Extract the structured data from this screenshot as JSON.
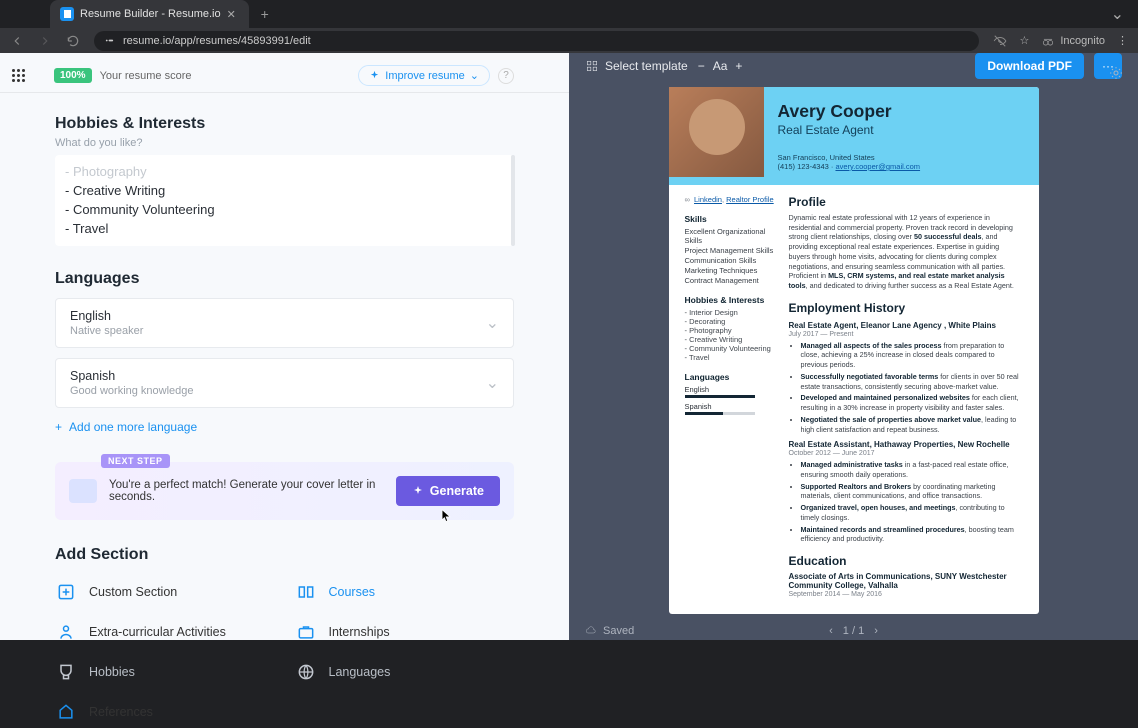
{
  "browser": {
    "tab_title": "Resume Builder - Resume.io",
    "url": "resume.io/app/resumes/45893991/edit",
    "incognito": "Incognito"
  },
  "topbar": {
    "score": "100%",
    "score_label": "Your resume score",
    "improve": "Improve resume"
  },
  "hobbies": {
    "title": "Hobbies & Interests",
    "hint": "What do you like?",
    "items": [
      "- Photography",
      "- Creative Writing",
      "- Community Volunteering",
      "- Travel"
    ]
  },
  "languages": {
    "title": "Languages",
    "items": [
      {
        "name": "English",
        "level": "Native speaker"
      },
      {
        "name": "Spanish",
        "level": "Good working knowledge"
      }
    ],
    "add": "Add one more language"
  },
  "nextstep": {
    "tag": "NEXT STEP",
    "text": "You're a perfect match! Generate your cover letter in seconds.",
    "button": "Generate"
  },
  "addsection": {
    "title": "Add Section",
    "items": {
      "custom": "Custom Section",
      "courses": "Courses",
      "extra": "Extra-curricular Activities",
      "intern": "Internships",
      "hobbies": "Hobbies",
      "languages": "Languages",
      "refs": "References"
    }
  },
  "previewbar": {
    "select_template": "Select template",
    "download": "Download PDF",
    "aa": "Aa"
  },
  "resume": {
    "name": "Avery Cooper",
    "role": "Real Estate Agent",
    "location": "San Francisco, United States",
    "phone": "(415) 123-4343",
    "email": "avery.cooper@gmail.com",
    "links_label": "Linkedin",
    "links_label2": "Realtor Profile",
    "skills_h": "Skills",
    "skills": [
      "Excellent Organizational Skills",
      "Project Management Skills",
      "Communication Skills",
      "Marketing Techniques",
      "Contract Management"
    ],
    "hobbies_h": "Hobbies & Interests",
    "hobbies": [
      "- Interior Design",
      "- Decorating",
      "- Photography",
      "- Creative Writing",
      "- Community Volunteering",
      "- Travel"
    ],
    "langs_h": "Languages",
    "profile_h": "Profile",
    "profile_body_pre": "Dynamic real estate professional with 12 years of experience in residential and commercial property. Proven track record in developing strong client relationships, closing over ",
    "profile_b1": "50 successful deals",
    "profile_mid": ", and providing exceptional real estate experiences. Expertise in guiding buyers through home visits, advocating for clients during complex negotiations, and ensuring seamless communication with all parties. Proficient in ",
    "profile_b2": "MLS, CRM systems, and real estate market analysis tools",
    "profile_end": ", and dedicated to driving further success as a Real Estate Agent.",
    "emp_h": "Employment History",
    "job1_t": "Real Estate Agent, Eleanor Lane Agency , White Plains",
    "job1_d": "July 2017 — Present",
    "job1_b": [
      {
        "b": "Managed all aspects of the sales process",
        "t": " from preparation to close, achieving a 25% increase in closed deals compared to previous periods."
      },
      {
        "b": "Successfully negotiated favorable terms",
        "t": " for clients in over 50 real estate transactions, consistently securing above-market value."
      },
      {
        "b": "Developed and maintained personalized websites",
        "t": " for each client, resulting in a 30% increase in property visibility and faster sales."
      },
      {
        "b": "Negotiated the sale of properties above market value",
        "t": ", leading to high client satisfaction and repeat business."
      }
    ],
    "job2_t": "Real Estate Assistant, Hathaway Properties, New Rochelle",
    "job2_d": "October 2012 — June 2017",
    "job2_b": [
      {
        "b": "Managed administrative tasks",
        "t": " in a fast-paced real estate office, ensuring smooth daily operations."
      },
      {
        "b": "Supported Realtors and Brokers",
        "t": " by coordinating marketing materials, client communications, and office transactions."
      },
      {
        "b": "Organized travel, open houses, and meetings",
        "t": ", contributing to timely closings."
      },
      {
        "b": "Maintained records and streamlined procedures",
        "t": ", boosting team efficiency and productivity."
      }
    ],
    "edu_h": "Education",
    "edu_t": "Associate of Arts in Communications, SUNY Westchester Community College, Valhalla",
    "edu_d": "September 2014 — May 2016"
  },
  "bottom": {
    "saved": "Saved",
    "page": "1 / 1"
  }
}
